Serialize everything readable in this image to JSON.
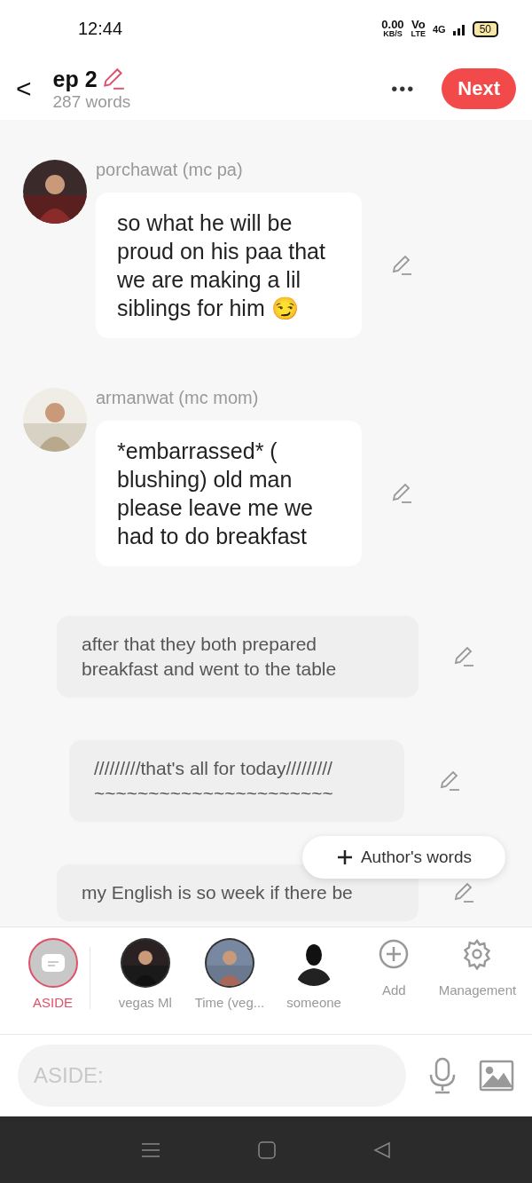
{
  "status_bar": {
    "time": "12:44",
    "speed": "0.00",
    "speed_unit": "KB/S",
    "volte": "Vo",
    "volte_sub": "LTE",
    "network": "4G",
    "battery": "50"
  },
  "header": {
    "back": "<",
    "title": "ep 2",
    "word_count": "287 words",
    "more": "•••",
    "next_button": "Next"
  },
  "messages": [
    {
      "kind": "dialogue",
      "speaker": "porchawat (mc pa)",
      "text": "so what he will be proud on his paa that we are making a lil siblings for him 😏"
    },
    {
      "kind": "dialogue",
      "speaker": "armanwat (mc mom)",
      "text": "*embarrassed* ( blushing) old man please leave me we had to do breakfast"
    },
    {
      "kind": "narration",
      "text": "after that they both prepared breakfast and went to the table"
    },
    {
      "kind": "narration",
      "text": "/////////that's all for today/////////\n~~~~~~~~~~~~~~~~~~~~~~"
    },
    {
      "kind": "narration",
      "text": "my English is so week if there be"
    }
  ],
  "authors_words_button": "Author's words",
  "characters": [
    {
      "kind": "aside",
      "label": "ASIDE",
      "selected": true
    },
    {
      "kind": "avatar",
      "label": "vegas Ml",
      "selected": false
    },
    {
      "kind": "avatar",
      "label": "Time (veg...",
      "selected": false
    },
    {
      "kind": "silhouette",
      "label": "someone",
      "selected": false
    },
    {
      "kind": "add",
      "label": "Add"
    },
    {
      "kind": "manage",
      "label": "Management"
    }
  ],
  "input": {
    "placeholder": "ASIDE:"
  }
}
